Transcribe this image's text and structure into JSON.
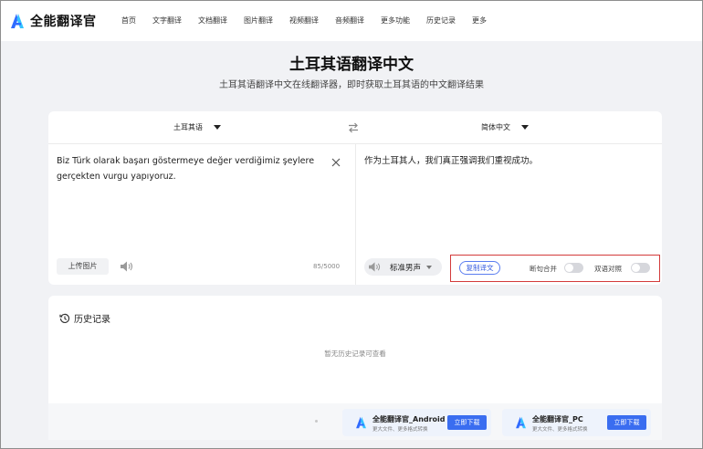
{
  "brand": {
    "name": "全能翻译官"
  },
  "nav": {
    "items": [
      "首页",
      "文字翻译",
      "文档翻译",
      "图片翻译",
      "视频翻译",
      "音频翻译",
      "更多功能",
      "历史记录",
      "更多"
    ]
  },
  "header": {
    "title": "土耳其语翻译中文",
    "subtitle": "土耳其语翻译中文在线翻译器，即时获取土耳其语的中文翻译结果"
  },
  "translator": {
    "source_lang": "土耳其语",
    "target_lang": "简体中文",
    "source_text": "Biz Türk olarak başarı göstermeye değer verdiğimiz şeylere gerçekten vurgu yapıyoruz.",
    "target_text": "作为土耳其人，我们真正强调我们重视成功。",
    "upload_label": "上传图片",
    "char_count": "85/5000",
    "voice_label": "标准男声",
    "copy_label": "复制译文",
    "sentence_merge_label": "断句合并",
    "bilingual_label": "双语对照",
    "sentence_merge_on": false,
    "bilingual_on": false
  },
  "history": {
    "title": "历史记录",
    "empty": "暂无历史记录可查看"
  },
  "downloads": [
    {
      "name": "全能翻译官_Android",
      "desc": "更大文件、更多格式转换",
      "button": "立即下载"
    },
    {
      "name": "全能翻译官_PC",
      "desc": "更大文件、更多格式转换",
      "button": "立即下载"
    }
  ],
  "colors": {
    "accent": "#3a6df0",
    "highlight_border": "#d33b3b"
  }
}
